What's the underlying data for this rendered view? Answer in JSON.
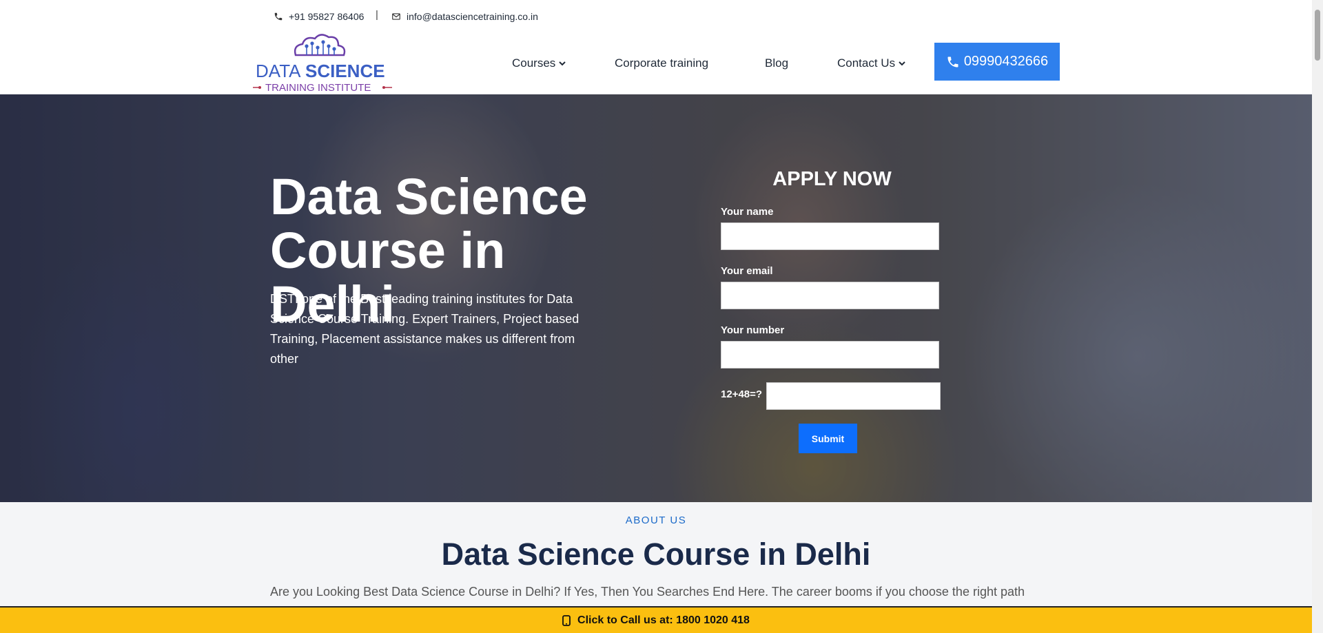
{
  "topbar": {
    "phone": "+91 95827 86406",
    "separator": "|",
    "email": "info@datasciencetraining.co.in"
  },
  "logo": {
    "line1a": "DATA",
    "line1b": "SCIENCE",
    "line2": "TRAINING INSTITUTE"
  },
  "nav": {
    "courses": "Courses",
    "corporate": "Corporate training",
    "blog": "Blog",
    "contact": "Contact Us",
    "call_number": "09990432666"
  },
  "hero": {
    "title": "Data Science Course in Delhi",
    "description": "DSTI one of the Best leading training institutes for Data Science Course Training. Expert Trainers, Project based Training, Placement assistance makes us different from other"
  },
  "form": {
    "title": "APPLY NOW",
    "name_label": "Your name",
    "email_label": "Your email",
    "number_label": "Your number",
    "captcha_label": "12+48=?",
    "submit_label": "Submit"
  },
  "about": {
    "kicker": "ABOUT US",
    "title": "Data Science Course in Delhi",
    "text": "Are you Looking Best Data Science Course in Delhi? If Yes, Then You Searches End Here. The career booms if you choose the right path"
  },
  "callbar": {
    "text": "Click to Call us at: 1800 1020 418"
  },
  "colors": {
    "accent_blue": "#2f80ed",
    "submit_blue": "#0d6efd",
    "callbar_yellow": "#fbbf10",
    "about_title": "#1a2a4a"
  }
}
